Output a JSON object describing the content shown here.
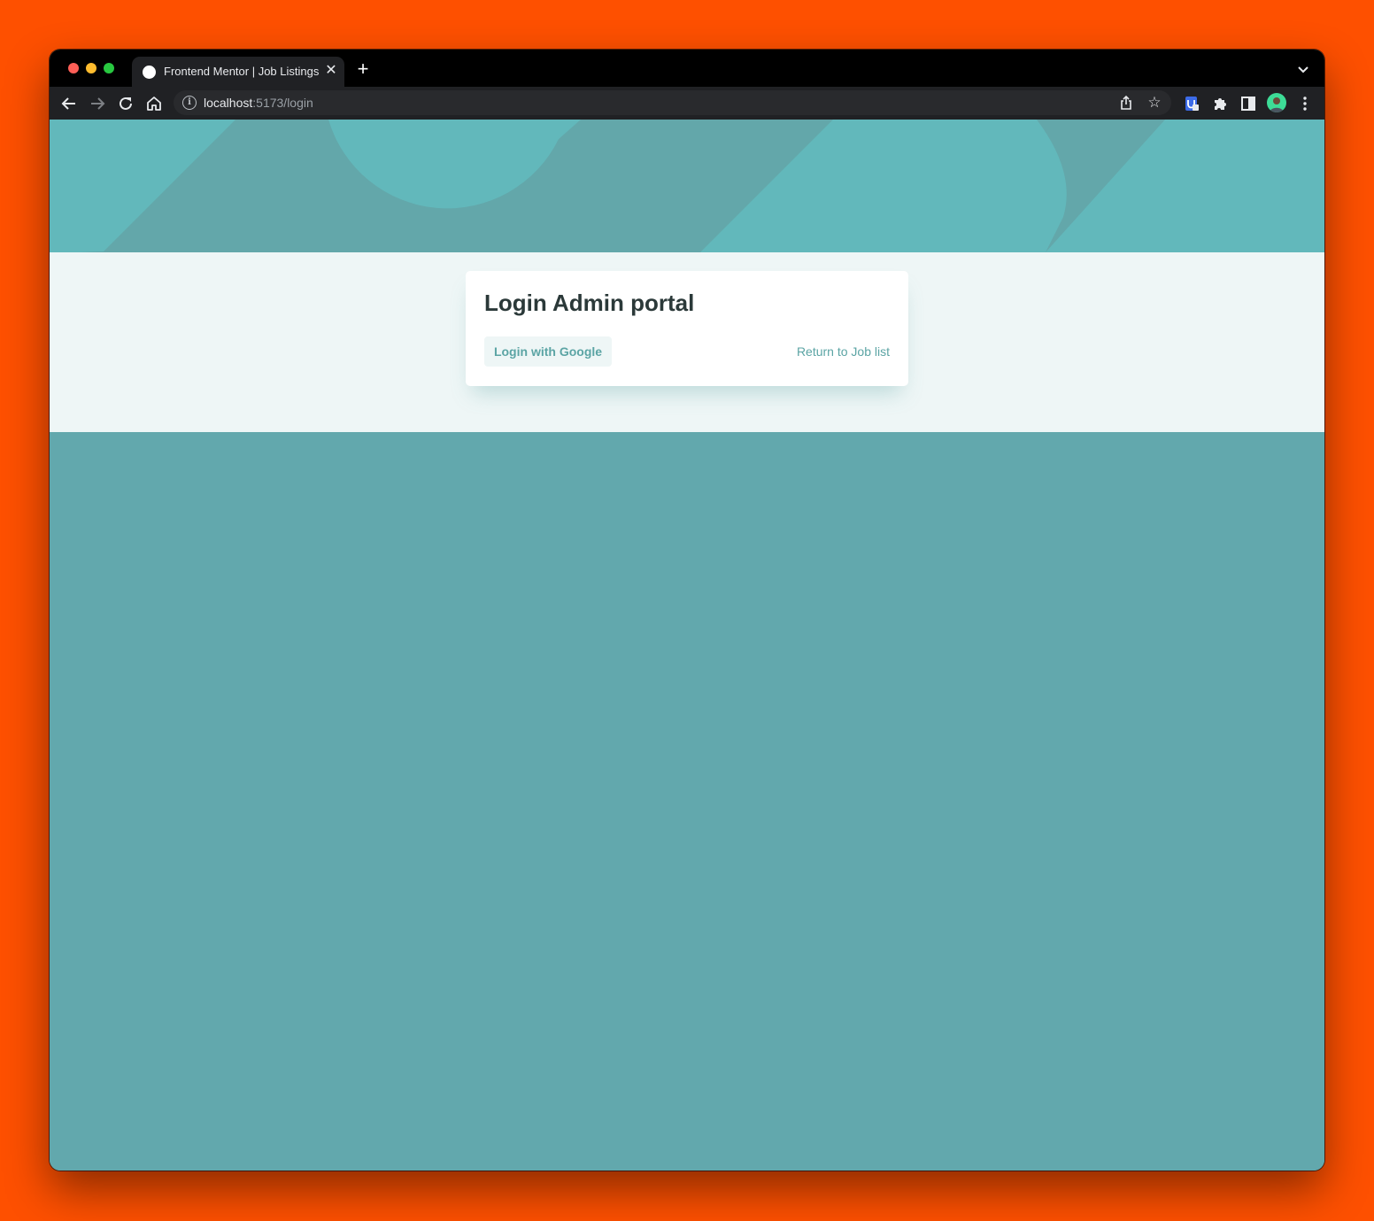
{
  "browser": {
    "tab_title": "Frontend Mentor | Job Listings",
    "url_host": "localhost",
    "url_path": ":5173/login"
  },
  "page": {
    "title": "Login Admin portal",
    "google_button": "Login with Google",
    "return_link": "Return to Job list"
  },
  "colors": {
    "primary": "#5ba4a4",
    "background": "#eef6f6",
    "heading": "#2b3939",
    "hero": "#62b8bb"
  },
  "icons": [
    "back-icon",
    "forward-icon",
    "reload-icon",
    "home-icon",
    "info-icon",
    "share-icon",
    "star-icon",
    "extension-icon",
    "puzzle-icon",
    "sidepanel-icon",
    "avatar",
    "menu-icon"
  ]
}
